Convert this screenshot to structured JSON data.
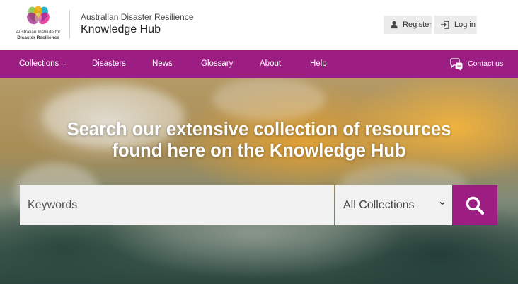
{
  "header": {
    "logo_line1": "Australian Institute for",
    "logo_line2": "Disaster Resilience",
    "site_subtitle": "Australian Disaster Resilience",
    "site_title": "Knowledge Hub",
    "register_label": "Register",
    "login_label": "Log in"
  },
  "nav": {
    "items": [
      {
        "label": "Collections",
        "icon": "chevron-down-icon"
      },
      {
        "label": "Disasters"
      },
      {
        "label": "News"
      },
      {
        "label": "Glossary"
      },
      {
        "label": "About"
      },
      {
        "label": "Help"
      }
    ],
    "contact_label": "Contact us",
    "contact_icon": "chat-bubbles-icon",
    "background": "#9c1e83"
  },
  "hero": {
    "title_line1": "Search our extensive collection of resources",
    "title_line2": "found here on the Knowledge Hub",
    "search_placeholder": "Keywords",
    "collection_selected": "All Collections",
    "search_icon": "search-icon"
  },
  "colors": {
    "accent": "#9c1e83",
    "button_grey": "#ececec",
    "input_bg": "#f2f2f2"
  }
}
